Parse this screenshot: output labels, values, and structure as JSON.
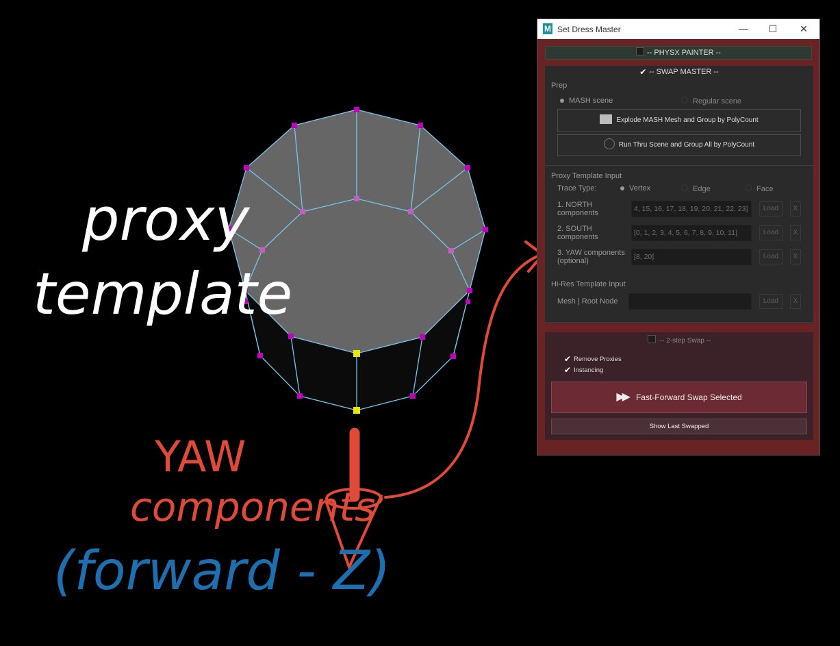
{
  "annotations": {
    "proxy_line1": "proxy",
    "proxy_line2": "template",
    "yaw_line1": "YAW",
    "yaw_line2": "components",
    "forward_z": "(forward - Z)"
  },
  "window": {
    "title": "Set Dress Master",
    "logo": "M",
    "minimize": "—",
    "maximize": "☐",
    "close": "✕"
  },
  "physx": {
    "label": "--  PHYSX PAINTER  --",
    "checked": false
  },
  "swap_master": {
    "label": "--  SWAP MASTER  --",
    "check_mark": "✔",
    "prep": {
      "heading": "Prep",
      "mash_scene": "MASH scene",
      "regular_scene": "Regular scene",
      "explode_button": "Explode MASH Mesh and Group by PolyCount",
      "run_thru_button": "Run Thru Scene and Group All by PolyCount"
    },
    "proxy_input": {
      "heading": "Proxy Template Input",
      "trace_type_label": "Trace Type:",
      "trace_options": [
        "Vertex",
        "Edge",
        "Face"
      ],
      "rows": [
        {
          "label1": "1. NORTH",
          "label2": "components",
          "value": "4, 15, 16, 17, 18, 19, 20, 21, 22, 23]",
          "load": "Load",
          "clear": "X"
        },
        {
          "label1": "2. SOUTH",
          "label2": "components",
          "value": "[0, 1, 2, 3, 4, 5, 6, 7, 8, 9, 10, 11]",
          "load": "Load",
          "clear": "X"
        },
        {
          "label1": "3. YAW components",
          "label2": "(optional)",
          "value": "[8, 20]",
          "load": "Load",
          "clear": "X"
        }
      ]
    },
    "hires_input": {
      "heading": "Hi-Res Template Input",
      "label": "Mesh | Root Node",
      "value": "",
      "load": "Load",
      "clear": "X"
    }
  },
  "two_step": {
    "label": "--  2-step Swap  --",
    "remove_proxies": "Remove Proxies",
    "instancing": "Instancing",
    "check_mark": "✔",
    "fast_forward_icon": "▶▶",
    "fast_forward": "Fast-Forward Swap Selected",
    "show_last": "Show Last Swapped"
  },
  "colors": {
    "mesh_wire": "#76c7ee",
    "vertex": "#c000c0",
    "yaw_vertex": "#e6e600",
    "annotation_red": "#e04a38",
    "annotation_blue": "#1e6fb0",
    "frame_red": "#6a2325"
  }
}
